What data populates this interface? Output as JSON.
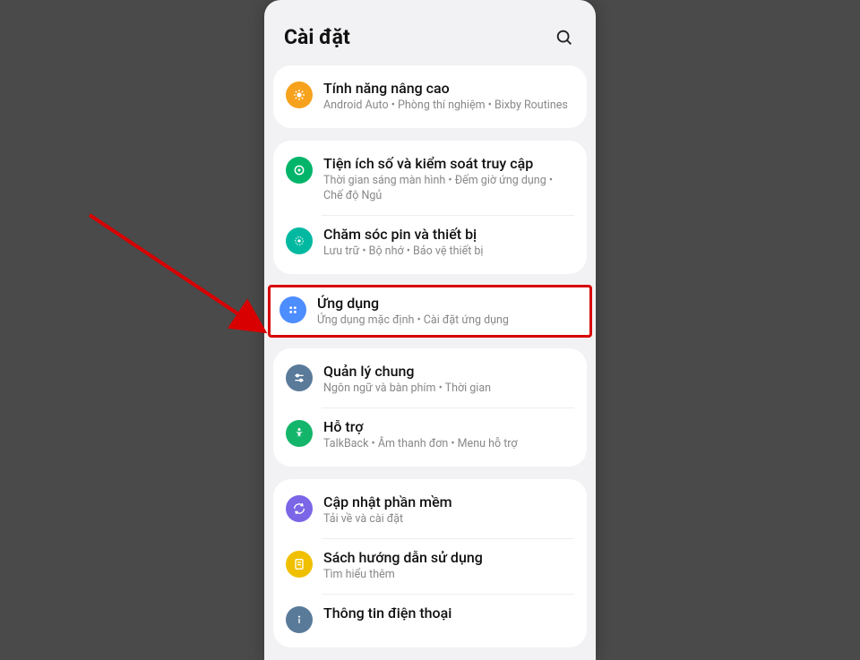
{
  "header": {
    "title": "Cài đặt"
  },
  "groups": [
    {
      "items": [
        {
          "title": "Tính năng nâng cao",
          "subtitle": "Android Auto  •  Phòng thí nghiệm  •  Bixby Routines",
          "iconColor": "c-orange",
          "iconName": "gear-plus-icon"
        }
      ]
    },
    {
      "items": [
        {
          "title": "Tiện ích số và kiểm soát truy cập",
          "subtitle": "Thời gian sáng màn hình  •  Đếm giờ ứng dụng  •  Chế độ Ngủ",
          "iconColor": "c-green1",
          "iconName": "wellbeing-icon"
        },
        {
          "title": "Chăm sóc pin và thiết bị",
          "subtitle": "Lưu trữ  •  Bộ nhớ  •  Bảo vệ thiết bị",
          "iconColor": "c-teal",
          "iconName": "device-care-icon"
        }
      ]
    }
  ],
  "highlight": {
    "title": "Ứng dụng",
    "subtitle": "Ứng dụng mặc định  •  Cài đặt ứng dụng",
    "iconColor": "c-blue",
    "iconName": "apps-icon"
  },
  "groups2": [
    {
      "items": [
        {
          "title": "Quản lý chung",
          "subtitle": "Ngôn ngữ và bàn phím  •  Thời gian",
          "iconColor": "c-slate",
          "iconName": "sliders-icon"
        },
        {
          "title": "Hỗ trợ",
          "subtitle": "TalkBack  •  Âm thanh đơn  •  Menu hỗ trợ",
          "iconColor": "c-green2",
          "iconName": "accessibility-icon"
        }
      ]
    },
    {
      "items": [
        {
          "title": "Cập nhật phần mềm",
          "subtitle": "Tải về và cài đặt",
          "iconColor": "c-violet",
          "iconName": "update-icon"
        },
        {
          "title": "Sách hướng dẫn sử dụng",
          "subtitle": "Tìm hiểu thêm",
          "iconColor": "c-yellow",
          "iconName": "manual-icon"
        },
        {
          "title": "Thông tin điện thoại",
          "subtitle": "",
          "iconColor": "c-slate",
          "iconName": "info-icon"
        }
      ]
    }
  ]
}
